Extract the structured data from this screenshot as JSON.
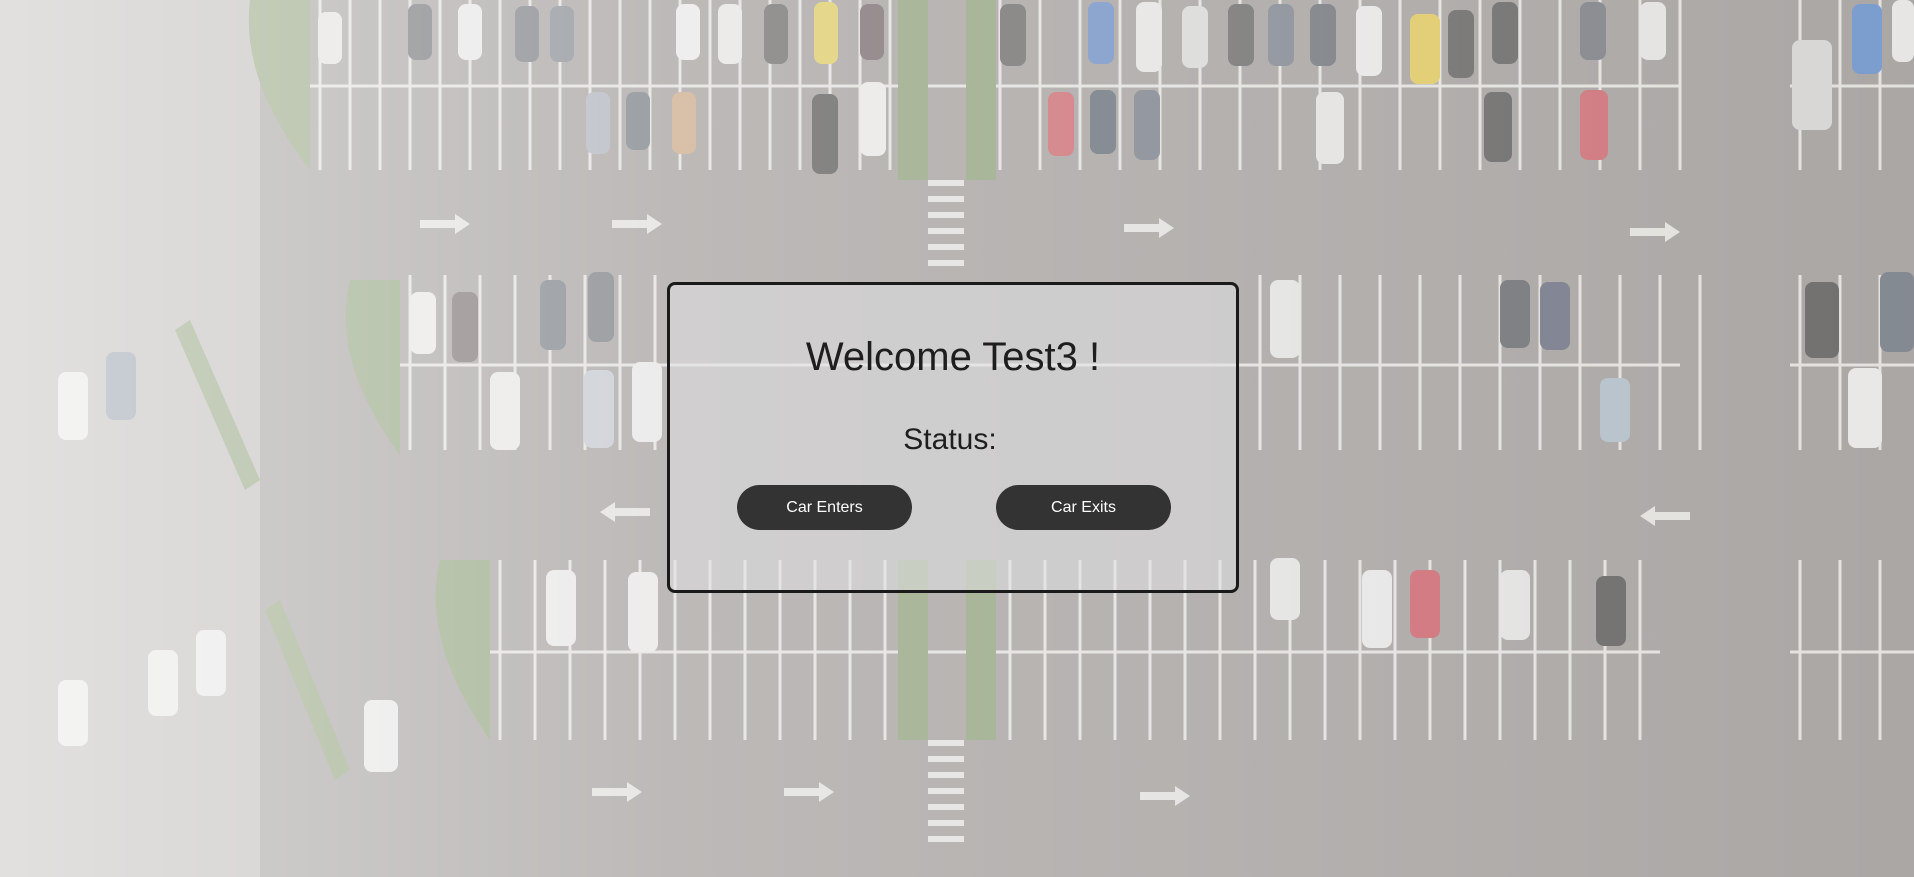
{
  "welcome": {
    "title": "Welcome Test3 !"
  },
  "status": {
    "label": "Status:",
    "value": ""
  },
  "actions": {
    "enter_label": "Car Enters",
    "exit_label": "Car Exits"
  },
  "colors": {
    "button_bg": "#333333",
    "button_text": "#ffffff",
    "card_border": "#1a1a1a",
    "asphalt": "#8a8684",
    "lane_lines": "#ffffff",
    "grass": "#6f8a55"
  }
}
